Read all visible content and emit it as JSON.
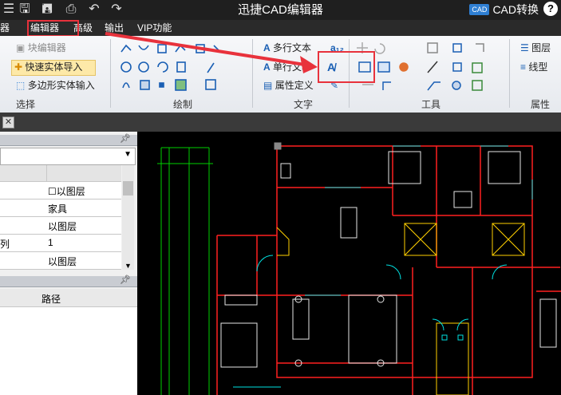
{
  "app": {
    "title": "迅捷CAD编辑器",
    "convert_label": "CAD转换",
    "convert_badge": "CAD",
    "help": "?"
  },
  "menu": {
    "items": [
      "器",
      "编辑器",
      "高级",
      "输出",
      "VIP功能"
    ]
  },
  "ribbon": {
    "select_group": {
      "label": "选择",
      "block_editor": "块编辑器",
      "quick_import": "快速实体导入",
      "polygon_input": "多边形实体输入"
    },
    "draw_group": {
      "label": "绘制"
    },
    "text_group": {
      "label": "文字",
      "multiline": "多行文本",
      "single": "单行文本",
      "attr_def": "属性定义"
    },
    "tools_group": {
      "label": "工具"
    },
    "props_group": {
      "label": "属性",
      "layer": "图层",
      "linetype": "线型"
    }
  },
  "left_panel": {
    "properties": [
      "以图层",
      "家具",
      "以图层",
      "1",
      "以图层"
    ],
    "row4_fragment": "列",
    "path_header": "路径"
  },
  "colors": {
    "highlight": "#e8323c",
    "accent_blue": "#2f7fd3",
    "canvas": "#000000"
  }
}
